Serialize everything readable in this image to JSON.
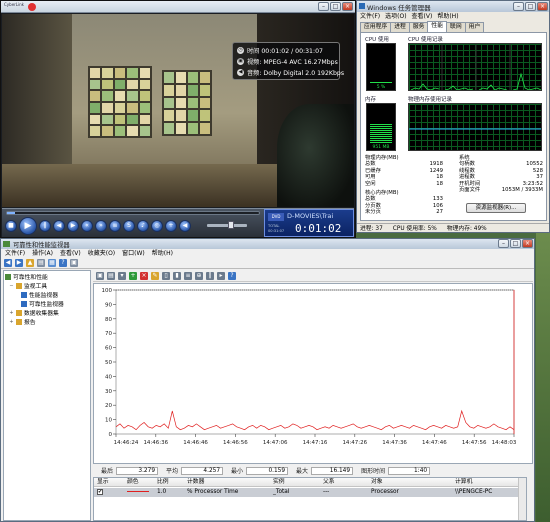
{
  "player": {
    "logo_text": "CyberLink",
    "osd": {
      "time": "时间 00:01:02 / 00:31:07",
      "video": "视频: MPEG-4 AVC 16.27Mbps",
      "audio": "音频: Dolby Digital 2.0  192Kbps"
    },
    "lcd": {
      "tag": "DVD",
      "title": "D-MOVIES\\Trai",
      "sub": "TOTAL 00:31:07",
      "time": "0:01:02"
    },
    "progress_fraction": 0.033,
    "volume_fraction": 0.6
  },
  "taskmgr": {
    "title": "Windows 任务管理器",
    "menu": [
      "文件(F)",
      "选项(O)",
      "查看(V)",
      "帮助(H)"
    ],
    "tabs": [
      "应用程序",
      "进程",
      "服务",
      "性能",
      "联网",
      "用户"
    ],
    "active_tab": 3,
    "cpu_usage_label": "CPU 使用",
    "cpu_history_label": "CPU 使用记录",
    "cpu_gauge_value": "5 %",
    "cpu_percent": 5,
    "mem_label": "内存",
    "mem_history_label": "物理内存使用记录",
    "mem_gauge_value": "951 MB",
    "mem_percent": 49,
    "physmem": {
      "title": "物理内存(MB)",
      "rows": [
        [
          "总数",
          "1918"
        ],
        [
          "已缓存",
          "1249"
        ],
        [
          "可用",
          "18"
        ],
        [
          "空闲",
          "18"
        ]
      ]
    },
    "system": {
      "title": "系统",
      "rows": [
        [
          "句柄数",
          "10552"
        ],
        [
          "线程数",
          "528"
        ],
        [
          "进程数",
          "37"
        ],
        [
          "开机时间",
          "3:23:52"
        ],
        [
          "页面文件",
          "1053M / 3933M"
        ]
      ]
    },
    "kernel": {
      "title": "核心内存(MB)",
      "rows": [
        [
          "总数",
          "133"
        ],
        [
          "分页数",
          "106"
        ],
        [
          "未分页",
          "27"
        ]
      ]
    },
    "resmon_button": "资源监视器(R)...",
    "status": {
      "processes": "进程: 37",
      "cpu": "CPU 使用率: 5%",
      "memory": "物理内存: 49%"
    }
  },
  "perfmon": {
    "title": "可靠性和性能监视器",
    "menu": [
      "文件(F)",
      "操作(A)",
      "查看(V)",
      "收藏夹(O)",
      "窗口(W)",
      "帮助(H)"
    ],
    "tree": [
      {
        "label": "可靠性和性能",
        "level": 0
      },
      {
        "label": "监视工具",
        "level": 1
      },
      {
        "label": "性能监视器",
        "level": 2
      },
      {
        "label": "可靠性监视器",
        "level": 2
      },
      {
        "label": "数据收集器集",
        "level": 1
      },
      {
        "label": "报告",
        "level": 1
      }
    ],
    "stats": {
      "last_label": "最后",
      "last_value": "3.279",
      "avg_label": "平均",
      "avg_value": "4.257",
      "min_label": "最小",
      "min_value": "0.159",
      "max_label": "最大",
      "max_value": "16.149",
      "duration_label": "图形时间",
      "duration_value": "1:40"
    },
    "table": {
      "headers": [
        "显示",
        "颜色",
        "比例",
        "计数器",
        "实例",
        "父系",
        "对象",
        "计算机"
      ],
      "row": {
        "scale": "1.0",
        "counter": "% Processor Time",
        "instance": "_Total",
        "parent": "---",
        "object": "Processor",
        "computer": "\\\\PENGCE-PC"
      }
    }
  },
  "chart_data": {
    "type": "line",
    "ylim": [
      0,
      100
    ],
    "yticks": [
      0,
      10,
      20,
      30,
      40,
      50,
      60,
      70,
      80,
      90,
      100
    ],
    "xticks": [
      "14:46:24",
      "14:46:36",
      "14:46:46",
      "14:46:56",
      "14:47:06",
      "14:47:16",
      "14:47:26",
      "14:47:36",
      "14:47:46",
      "14:47:56",
      "14:48:03"
    ],
    "series": [
      {
        "name": "% Processor Time",
        "color": "#e02020",
        "values": [
          5,
          7,
          4,
          6,
          5,
          3,
          6,
          8,
          5,
          4,
          6,
          5,
          7,
          4,
          16,
          5,
          3,
          4,
          6,
          5,
          7,
          5,
          3,
          4,
          5,
          6,
          4,
          5,
          6,
          7,
          5,
          4,
          3,
          5,
          6,
          4,
          6,
          5,
          3,
          4,
          5,
          6,
          4,
          5,
          7,
          6,
          4,
          5,
          6,
          5,
          3,
          4,
          5,
          4,
          6,
          5,
          4,
          5,
          6,
          7,
          5,
          4,
          5,
          6,
          5,
          4,
          3,
          5,
          6,
          4,
          5,
          6,
          5,
          4,
          6,
          5,
          4,
          3,
          5,
          6,
          5,
          4,
          6,
          5,
          4,
          5,
          16,
          8,
          5,
          4,
          6,
          5,
          4,
          5,
          7,
          5,
          4,
          3,
          5,
          3
        ]
      }
    ]
  }
}
